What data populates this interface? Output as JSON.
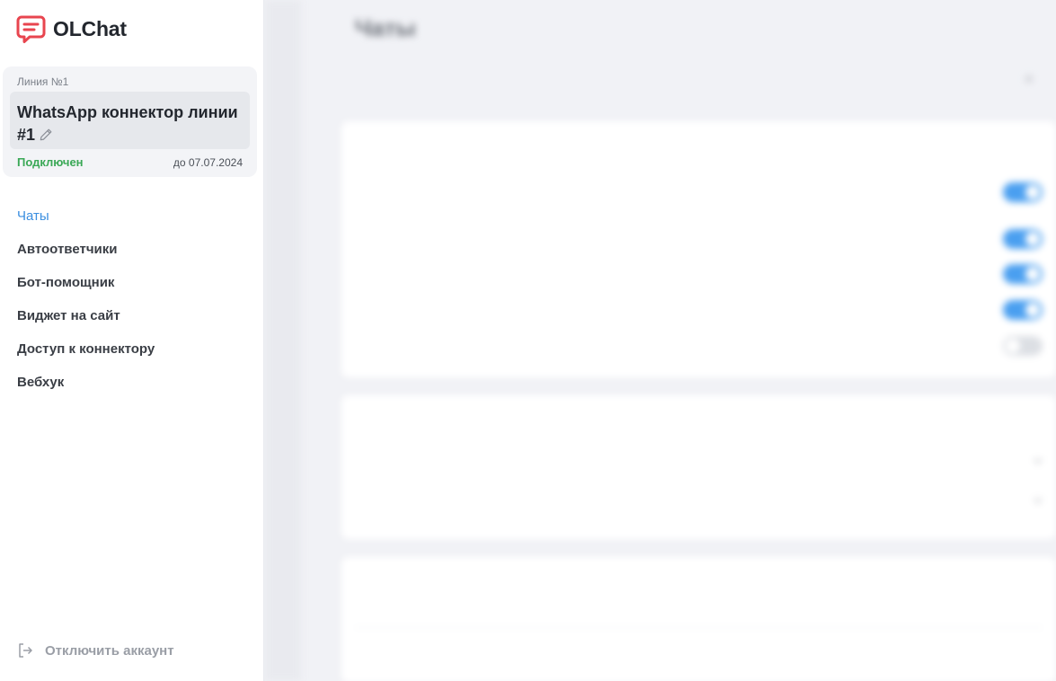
{
  "app": {
    "name": "OLChat"
  },
  "line_card": {
    "line_label": "Линия №1",
    "connector_name": "WhatsApp коннектор линии #1",
    "status": "Подключен",
    "until": "до 07.07.2024"
  },
  "nav": {
    "items": [
      {
        "label": "Чаты",
        "active": true
      },
      {
        "label": "Автоответчики",
        "active": false
      },
      {
        "label": "Бот-помощник",
        "active": false
      },
      {
        "label": "Виджет на сайт",
        "active": false
      },
      {
        "label": "Доступ к коннектору",
        "active": false
      },
      {
        "label": "Вебхук",
        "active": false
      }
    ]
  },
  "logout": {
    "label": "Отключить аккаунт"
  },
  "main": {
    "title": "Чаты",
    "description": "",
    "card1": {
      "title": "",
      "toggles": [
        {
          "label": "",
          "on": true
        },
        {
          "label": "",
          "on": true
        },
        {
          "label": "",
          "on": true
        },
        {
          "label": "",
          "on": true
        },
        {
          "label": "",
          "on": false
        }
      ]
    },
    "card2": {
      "title": "",
      "rows": [
        {
          "label": "",
          "value": ""
        },
        {
          "label": "",
          "value": ""
        }
      ]
    },
    "card3": {
      "title": "",
      "subtitle": ""
    }
  },
  "colors": {
    "accent": "#3b8fe0",
    "status_ok": "#3aa856",
    "logo": "#e8454f",
    "toggle_on": "#4a9ff0"
  }
}
